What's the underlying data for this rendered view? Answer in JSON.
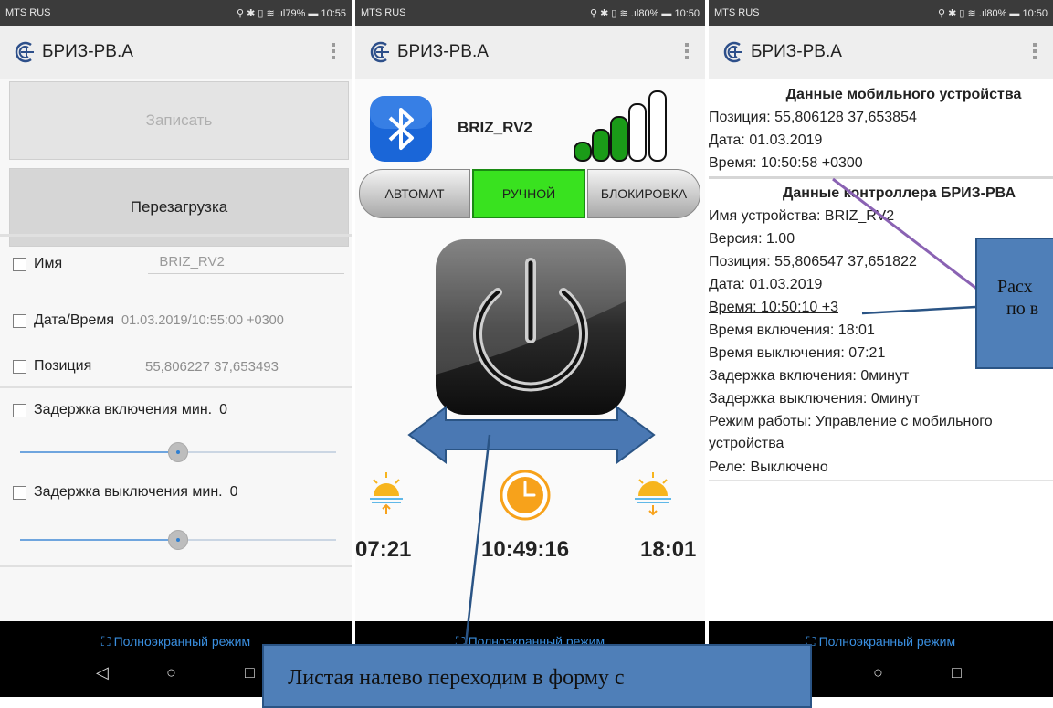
{
  "panel1": {
    "status": {
      "carrier": "MTS RUS",
      "right": "⚲ ✱ ▯ ≋ .ıl79% ▬ 10:55"
    },
    "app_title": "БРИЗ-РВ.А",
    "write_button": "Записать",
    "reboot_button": "Перезагрузка",
    "name_label": "Имя",
    "name_value": "BRIZ_RV2",
    "datetime_label": "Дата/Время",
    "datetime_value": "01.03.2019/10:55:00 +0300",
    "position_label": "Позиция",
    "position_value": "55,806227  37,653493",
    "on_delay_label": "Задержка включения мин.",
    "on_delay_value": "0",
    "on_delay_level": 0.5,
    "off_delay_label": "Задержка выключения мин.",
    "off_delay_value": "0",
    "off_delay_level": 0.5,
    "fullscreen": "Полноэкранный режим"
  },
  "panel2": {
    "status": {
      "carrier": "MTS RUS",
      "right": "⚲ ✱ ▯ ≋ .ıl80% ▬ 10:50"
    },
    "app_title": "БРИЗ-РВ.А",
    "device_name": "BRIZ_RV2",
    "modes": [
      "АВТОМАТ",
      "РУЧНОЙ",
      "БЛОКИРОВКА"
    ],
    "active_mode": "РУЧНОЙ",
    "sunrise_time": "07:21",
    "current_time": "10:49:16",
    "sunset_time": "18:01",
    "fullscreen": "Полноэкранный режим",
    "colors": {
      "active_mode": "#39e21f",
      "signal": "#1a9b18",
      "bluetooth": "#1a66d8",
      "clock": "#f7a21b",
      "sun": "#f7b51d"
    }
  },
  "panel3": {
    "status": {
      "carrier": "MTS RUS",
      "right": "⚲ ✱ ▯ ≋ .ıl80% ▬ 10:50"
    },
    "app_title": "БРИЗ-РВ.А",
    "mobile_header": "Данные мобильного устройства",
    "mobile_position": "Позиция: 55,806128   37,653854",
    "mobile_date": "Дата: 01.03.2019",
    "mobile_time": "Время: 10:50:58 +0300",
    "ctrl_header": "Данные контроллера БРИЗ-РВА",
    "ctrl_name": "Имя устройства: BRIZ_RV2",
    "ctrl_version": "Версия: 1.00",
    "ctrl_position": "Позиция: 55,806547   37,651822",
    "ctrl_date": "Дата: 01.03.2019",
    "ctrl_time": "Время: 10:50:10 +3",
    "ctrl_on_time": "Время включения: 18:01",
    "ctrl_off_time": "Время выключения: 07:21",
    "ctrl_on_delay": "Задержка включения: 0минут",
    "ctrl_off_delay": "Задержка выключения: 0минут",
    "ctrl_mode_1": "Режим работы: Управление с мобильного",
    "ctrl_mode_2": "устройства",
    "ctrl_relay": "Реле: Выключено",
    "fullscreen": "Полноэкранный режим"
  },
  "callouts": {
    "right_line1": "Расх",
    "right_line2": "по в",
    "bottom": "Листая налево переходим в форму с"
  }
}
